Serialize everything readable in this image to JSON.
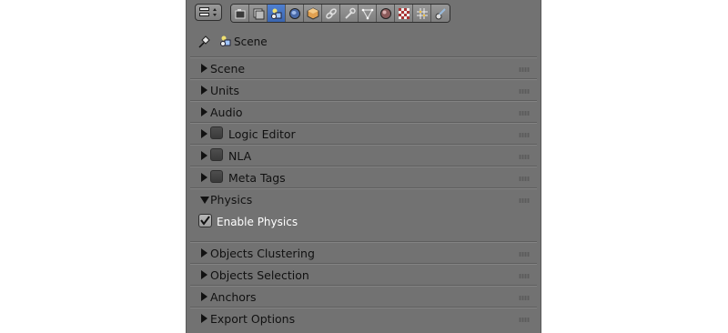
{
  "header": {
    "tabs": [
      {
        "icon": "render-icon",
        "active": false
      },
      {
        "icon": "render-layers-icon",
        "active": false
      },
      {
        "icon": "scene-icon",
        "active": true
      },
      {
        "icon": "world-icon",
        "active": false
      },
      {
        "icon": "object-icon",
        "active": false
      },
      {
        "icon": "constraints-icon",
        "active": false
      },
      {
        "icon": "modifiers-icon",
        "active": false
      },
      {
        "icon": "data-icon",
        "active": false
      },
      {
        "icon": "material-icon",
        "active": false
      },
      {
        "icon": "texture-icon",
        "active": false
      },
      {
        "icon": "particles-icon",
        "active": false
      },
      {
        "icon": "physics-icon",
        "active": false
      }
    ]
  },
  "context": {
    "label": "Scene"
  },
  "sections": {
    "scene": "Scene",
    "units": "Units",
    "audio": "Audio",
    "logic_editor": "Logic Editor",
    "nla": "NLA",
    "meta_tags": "Meta Tags",
    "physics": "Physics",
    "enable_physics": "Enable Physics",
    "objects_clustering": "Objects Clustering",
    "objects_selection": "Objects Selection",
    "anchors": "Anchors",
    "export_options": "Export Options"
  },
  "colors": {
    "active_tab": "#4f7fd0",
    "panel_bg": "#727272"
  }
}
